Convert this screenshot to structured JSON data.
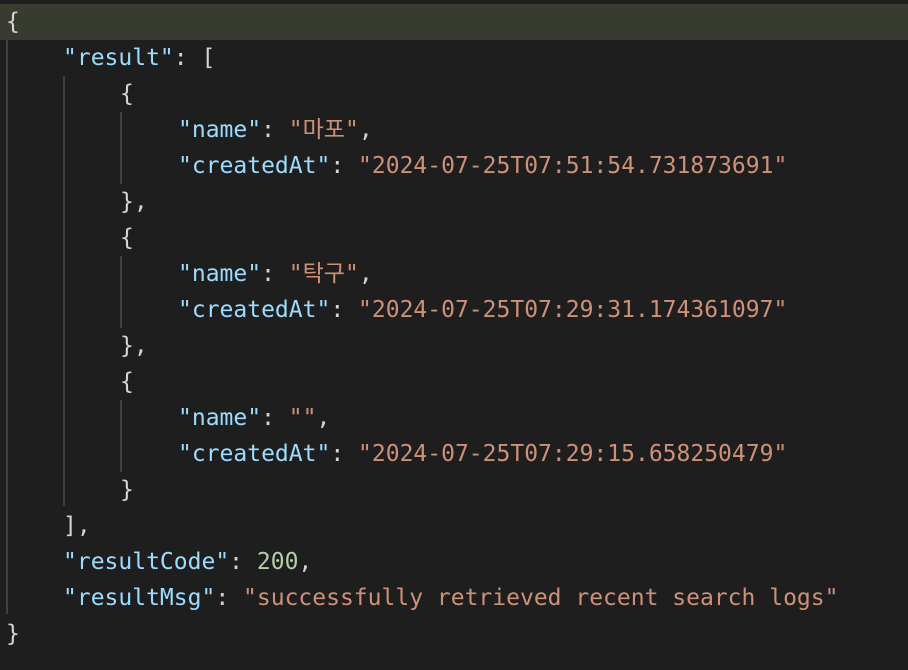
{
  "editor": {
    "open_brace": "{",
    "close_brace": "}",
    "result_key": "\"result\"",
    "result_open": "[",
    "result_close": "],",
    "colon": ": ",
    "comma": ",",
    "items": [
      {
        "open": "{",
        "name_key": "\"name\"",
        "name_value": "\"마포\"",
        "created_key": "\"createdAt\"",
        "created_value": "\"2024-07-25T07:51:54.731873691\"",
        "close": "},"
      },
      {
        "open": "{",
        "name_key": "\"name\"",
        "name_value": "\"탁구\"",
        "created_key": "\"createdAt\"",
        "created_value": "\"2024-07-25T07:29:31.174361097\"",
        "close": "},"
      },
      {
        "open": "{",
        "name_key": "\"name\"",
        "name_value": "\"\"",
        "created_key": "\"createdAt\"",
        "created_value": "\"2024-07-25T07:29:15.658250479\"",
        "close": "}"
      }
    ],
    "result_code_key": "\"resultCode\"",
    "result_code_value": "200",
    "result_msg_key": "\"resultMsg\"",
    "result_msg_value": "\"successfully retrieved recent search logs\"",
    "colors": {
      "background": "#1e1e1e",
      "current_line": "#383b30",
      "key": "#9cdcfe",
      "string": "#ce9178",
      "number": "#b5cea8",
      "punctuation": "#d4d4d4",
      "indent_guide": "#404040"
    }
  }
}
